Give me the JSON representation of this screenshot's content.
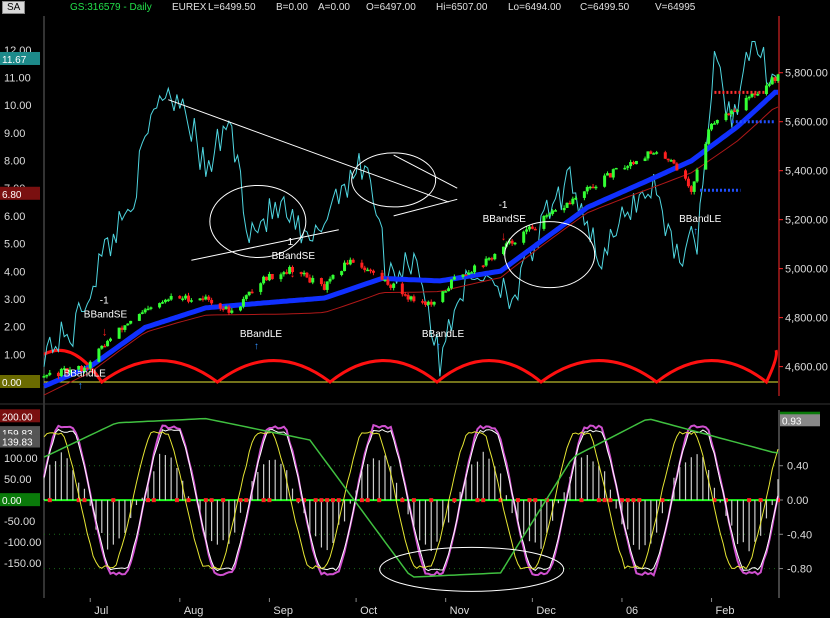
{
  "header": {
    "badge": "SA",
    "symbol": "GS:316579 - Daily",
    "exchange": "EUREX",
    "last": "L=6499.50",
    "bid": "B=0.00",
    "ask": "A=0.00",
    "open": "O=6497.00",
    "high": "Hi=6507.00",
    "low": "Lo=6494.00",
    "close": "C=6499.50",
    "volume": "V=64995"
  },
  "colors": {
    "background": "#000000",
    "ma_blue": "#1030ff",
    "up_bar": "#33ff33",
    "down_bar": "#ff2020",
    "cyan": "#4fd6e0",
    "price_axis": "#ff2a2a",
    "cycle": "#ff1010",
    "yellow": "#e6e633",
    "magenta": "#d050d0",
    "green_line": "#40c040"
  },
  "chart_data": [
    {
      "type": "candlestick",
      "title": "",
      "price_axis_ticks": [
        "5,800.00",
        "5,600.00",
        "5,400.00",
        "5,200.00",
        "5,000.00",
        "4,800.00",
        "4,600.00"
      ],
      "price_ylim": [
        4480,
        5950
      ],
      "left_axis_ticks": [
        "12.00",
        "11.00",
        "10.00",
        "9.00",
        "8.00",
        "7.00",
        "6.00",
        "5.00",
        "4.00",
        "3.00",
        "2.00",
        "1.00",
        "0.00"
      ],
      "left_ylim": [
        0,
        12.5
      ],
      "left_badges": [
        "11.67",
        "6.80",
        "0.00"
      ],
      "x_ticks": [
        "Jul",
        "Aug",
        "Sep",
        "Oct",
        "Nov",
        "Dec",
        "06",
        "Feb"
      ],
      "price_path": [
        [
          "2005-06-15",
          4560
        ],
        [
          "2005-06-30",
          4600
        ],
        [
          "2005-07-05",
          4680
        ],
        [
          "2005-07-15",
          4790
        ],
        [
          "2005-07-29",
          4880
        ],
        [
          "2005-08-10",
          4880
        ],
        [
          "2005-08-19",
          4820
        ],
        [
          "2005-08-30",
          4960
        ],
        [
          "2005-09-09",
          5000
        ],
        [
          "2005-09-20",
          4920
        ],
        [
          "2005-09-29",
          5040
        ],
        [
          "2005-10-07",
          4980
        ],
        [
          "2005-10-20",
          4880
        ],
        [
          "2005-10-28",
          4850
        ],
        [
          "2005-11-04",
          4960
        ],
        [
          "2005-11-15",
          5030
        ],
        [
          "2005-11-25",
          5120
        ],
        [
          "2005-12-05",
          5200
        ],
        [
          "2005-12-15",
          5280
        ],
        [
          "2005-12-30",
          5400
        ],
        [
          "2006-01-10",
          5470
        ],
        [
          "2006-01-18",
          5450
        ],
        [
          "2006-01-25",
          5320
        ],
        [
          "2006-02-01",
          5600
        ],
        [
          "2006-02-10",
          5660
        ],
        [
          "2006-02-23",
          5780
        ]
      ],
      "moving_average_blue": [
        [
          "2005-06-15",
          4520
        ],
        [
          "2005-07-01",
          4600
        ],
        [
          "2005-07-20",
          4760
        ],
        [
          "2005-08-10",
          4840
        ],
        [
          "2005-08-30",
          4860
        ],
        [
          "2005-09-20",
          4880
        ],
        [
          "2005-10-10",
          4960
        ],
        [
          "2005-10-30",
          4950
        ],
        [
          "2005-11-20",
          4990
        ],
        [
          "2005-12-05",
          5120
        ],
        [
          "2005-12-20",
          5250
        ],
        [
          "2006-01-10",
          5360
        ],
        [
          "2006-01-25",
          5440
        ],
        [
          "2006-02-10",
          5580
        ],
        [
          "2006-02-23",
          5720
        ]
      ],
      "annotations": [
        {
          "text": "BBandLE",
          "x": "2005-06-28",
          "y": 4560
        },
        {
          "text": "BBandSE",
          "x": "2005-07-05",
          "y": 4800
        },
        {
          "text": "BBandLE",
          "x": "2005-08-28",
          "y": 4720
        },
        {
          "text": "BBandSE",
          "x": "2005-09-08",
          "y": 5040
        },
        {
          "text": "BBandLE",
          "x": "2005-10-30",
          "y": 4720
        },
        {
          "text": "BBandSE",
          "x": "2005-11-20",
          "y": 5190
        },
        {
          "text": "BBandLE",
          "x": "2006-01-27",
          "y": 5190
        }
      ],
      "annotation_numbers": [
        "-1",
        "1",
        "-1",
        "1",
        "-1"
      ]
    },
    {
      "type": "line",
      "title": "",
      "left_axis_ticks": [
        "200.00",
        "150.00",
        "100.00",
        "50.00",
        "0.00",
        "-50.00",
        "-100.00",
        "-150.00"
      ],
      "left_ylim": [
        -200,
        215
      ],
      "left_badges": [
        "200.00",
        "159.83",
        "139.83",
        "0.00"
      ],
      "right_axis_ticks": [
        "0.40",
        "0.00",
        "-0.40",
        "-0.80"
      ],
      "right_ylim": [
        -0.98,
        1.05
      ],
      "right_badges": [
        "0.96",
        "0.93"
      ]
    }
  ]
}
